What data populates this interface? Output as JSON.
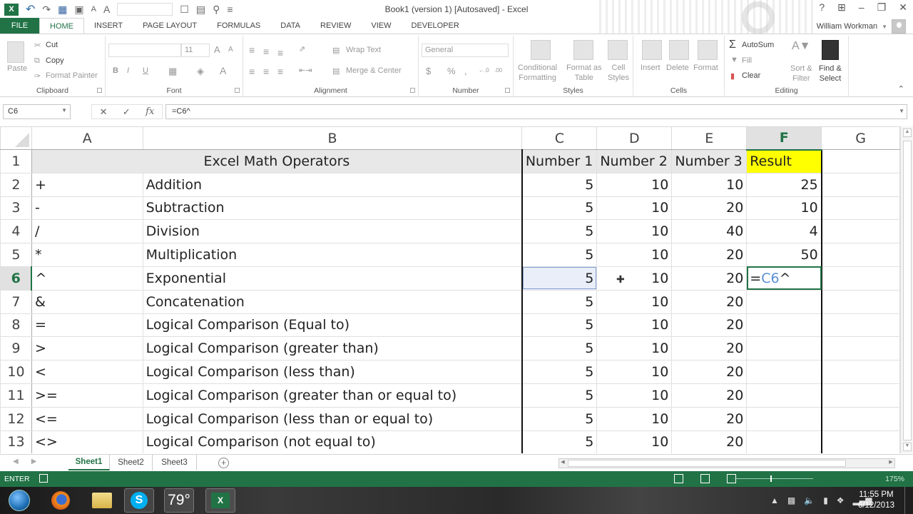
{
  "window": {
    "title": "Book1 (version 1) [Autosaved] - Excel",
    "controls": [
      "?",
      "⊞",
      "–",
      "❐",
      "✕"
    ]
  },
  "quick_access": {
    "app_icon": "X",
    "undo": "↶",
    "redo": "↷",
    "save": "🖫",
    "font_up": "A",
    "font_down": "A"
  },
  "ribbon_tabs": [
    "FILE",
    "HOME",
    "INSERT",
    "PAGE LAYOUT",
    "FORMULAS",
    "DATA",
    "REVIEW",
    "VIEW",
    "DEVELOPER"
  ],
  "active_tab": "HOME",
  "user": {
    "name": "William Workman"
  },
  "ribbon": {
    "clipboard": {
      "label": "Clipboard",
      "paste": "Paste",
      "cut": "Cut",
      "copy": "Copy",
      "format_painter": "Format Painter"
    },
    "font": {
      "label": "Font",
      "font_name": "",
      "font_size": "11",
      "bold": "B",
      "italic": "I",
      "underline": "U",
      "grow": "A",
      "shrink": "A",
      "font_color": "A"
    },
    "alignment": {
      "label": "Alignment",
      "wrap_text": "Wrap Text",
      "merge_center": "Merge & Center"
    },
    "number": {
      "label": "Number",
      "format": "General",
      "currency": "$",
      "percent": "%",
      "comma": ",",
      "inc_decimal": "←.0",
      "dec_decimal": ".00"
    },
    "styles": {
      "label": "Styles",
      "conditional": [
        "Conditional",
        "Formatting"
      ],
      "format_table": [
        "Format as",
        "Table"
      ],
      "cell_styles": [
        "Cell",
        "Styles"
      ]
    },
    "cells": {
      "label": "Cells",
      "insert": "Insert",
      "delete": "Delete",
      "format": "Format"
    },
    "editing": {
      "label": "Editing",
      "autosum": "AutoSum",
      "fill": "Fill",
      "clear": "Clear",
      "sort_filter": [
        "Sort &",
        "Filter"
      ],
      "find_select": [
        "Find &",
        "Select"
      ]
    }
  },
  "formula_bar": {
    "name_box": "C6",
    "cancel": "✕",
    "enter": "✓",
    "fx": "fx",
    "formula": "=C6^"
  },
  "grid": {
    "columns": [
      "A",
      "B",
      "C",
      "D",
      "E",
      "F",
      "G"
    ],
    "selected_column": "F",
    "selected_row": "6",
    "header_row": {
      "row": "1",
      "title": "Excel Math Operators",
      "c": "Number 1",
      "d": "Number 2",
      "e": "Number 3",
      "f": "Result"
    },
    "rows": [
      {
        "row": "2",
        "op": "+",
        "desc": "Addition",
        "c": "5",
        "d": "10",
        "e": "10",
        "f": "25"
      },
      {
        "row": "3",
        "op": "-",
        "desc": "Subtraction",
        "c": "5",
        "d": "10",
        "e": "20",
        "f": "10"
      },
      {
        "row": "4",
        "op": "/",
        "desc": "Division",
        "c": "5",
        "d": "10",
        "e": "40",
        "f": "4"
      },
      {
        "row": "5",
        "op": "*",
        "desc": "Multiplication",
        "c": "5",
        "d": "10",
        "e": "20",
        "f": "50"
      },
      {
        "row": "6",
        "op": "^",
        "desc": "Exponential",
        "c": "5",
        "d": "10",
        "e": "20",
        "f": ""
      },
      {
        "row": "7",
        "op": "&",
        "desc": "Concatenation",
        "c": "5",
        "d": "10",
        "e": "20",
        "f": ""
      },
      {
        "row": "8",
        "op": "=",
        "desc": "Logical Comparison (Equal to)",
        "c": "5",
        "d": "10",
        "e": "20",
        "f": ""
      },
      {
        "row": "9",
        "op": ">",
        "desc": "Logical Comparison (greater than)",
        "c": "5",
        "d": "10",
        "e": "20",
        "f": ""
      },
      {
        "row": "10",
        "op": "<",
        "desc": "Logical Comparison (less than)",
        "c": "5",
        "d": "10",
        "e": "20",
        "f": ""
      },
      {
        "row": "11",
        "op": ">=",
        "desc": "Logical Comparison (greater than or equal to)",
        "c": "5",
        "d": "10",
        "e": "20",
        "f": ""
      },
      {
        "row": "12",
        "op": "<=",
        "desc": "Logical Comparison (less than or equal to)",
        "c": "5",
        "d": "10",
        "e": "20",
        "f": ""
      },
      {
        "row": "13",
        "op": "<>",
        "desc": "Logical Comparison (not equal to)",
        "c": "5",
        "d": "10",
        "e": "20",
        "f": ""
      }
    ],
    "editing_cell": {
      "address": "F6",
      "prefix": "=",
      "ref": "C6",
      "suffix": "^"
    },
    "result_highlight_color": "#ffff00"
  },
  "sheet_tabs": [
    "Sheet1",
    "Sheet2",
    "Sheet3"
  ],
  "active_sheet": "Sheet1",
  "add_sheet": "+",
  "status_bar": {
    "mode": "ENTER",
    "zoom": "175%",
    "color": "#217346"
  },
  "taskbar": {
    "weather": "79°",
    "clock_time": "11:55 PM",
    "clock_date": "6/12/2013"
  }
}
